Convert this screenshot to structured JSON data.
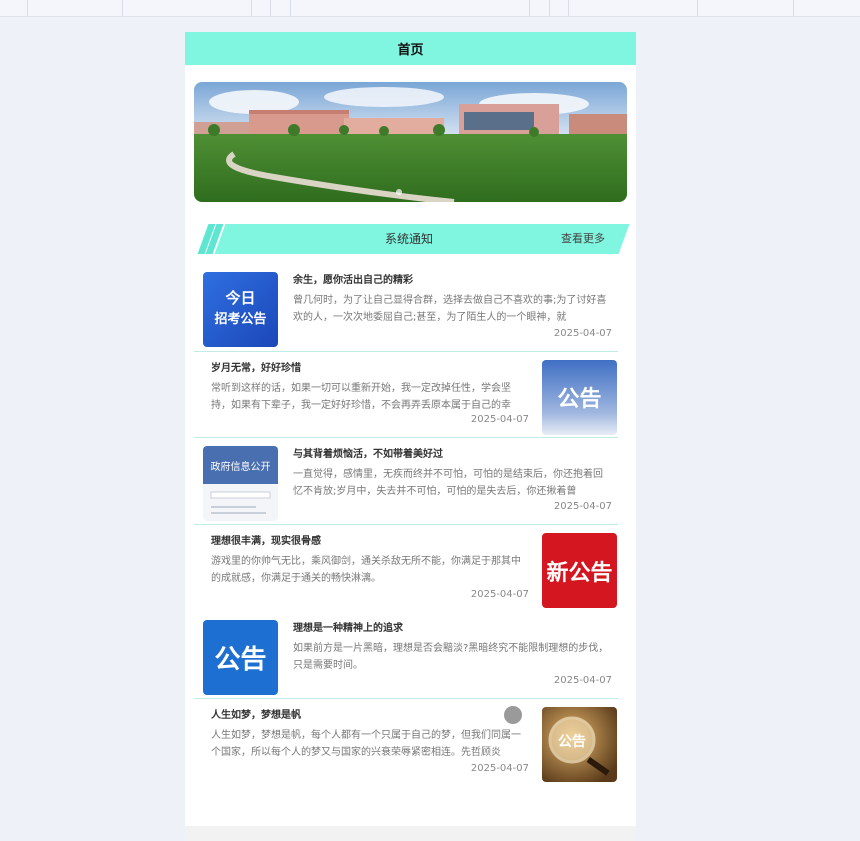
{
  "header": {
    "title": "首页"
  },
  "notice": {
    "title": "系统通知",
    "more": "查看更多"
  },
  "items": [
    {
      "title": "余生，愿你活出自己的精彩",
      "desc": "曾几何时，为了让自己显得合群，选择去做自己不喜欢的事;为了讨好喜欢的人，一次次地委屈自己;甚至，为了陌生人的一个眼神，就",
      "date": "2025-04-07",
      "thumb_text": [
        "今日",
        "招考公告"
      ]
    },
    {
      "title": "岁月无常，好好珍惜",
      "desc": "常听到这样的话，如果一切可以重新开始，我一定改掉任性，学会坚持，如果有下辈子，我一定好好珍惜，不会再弄丢原本属于自己的幸",
      "date": "2025-04-07",
      "thumb_text": "公告"
    },
    {
      "title": "与其背着烦恼活，不如带着美好过",
      "desc": "一直觉得，感情里，无疾而终并不可怕，可怕的是结束后，你还抱着回忆不肯放;岁月中，失去并不可怕，可怕的是失去后，你还揪着曾",
      "date": "2025-04-07",
      "thumb_text": "政府信息公开"
    },
    {
      "title": "理想很丰满，现实很骨感",
      "desc": "游戏里的你帅气无比，乘风御剑，通关杀敌无所不能，你满足于那其中的成就感，你满足于通关的畅快淋漓。",
      "date": "2025-04-07",
      "thumb_text": "新公告"
    },
    {
      "title": "理想是一种精神上的追求",
      "desc": "如果前方是一片黑暗，理想是否会黯淡?黑暗终究不能限制理想的步伐，只是需要时间。",
      "date": "2025-04-07",
      "thumb_text": "公告"
    },
    {
      "title": "人生如梦，梦想是帆",
      "desc": "人生如梦，梦想是帆，每个人都有一个只属于自己的梦，但我们同属一个国家，所以每个人的梦又与国家的兴衰荣辱紧密相连。先哲顾炎",
      "date": "2025-04-07",
      "thumb_text": "公告"
    }
  ],
  "colors": {
    "accent": "#80f5df",
    "divider": "#bfece4"
  }
}
